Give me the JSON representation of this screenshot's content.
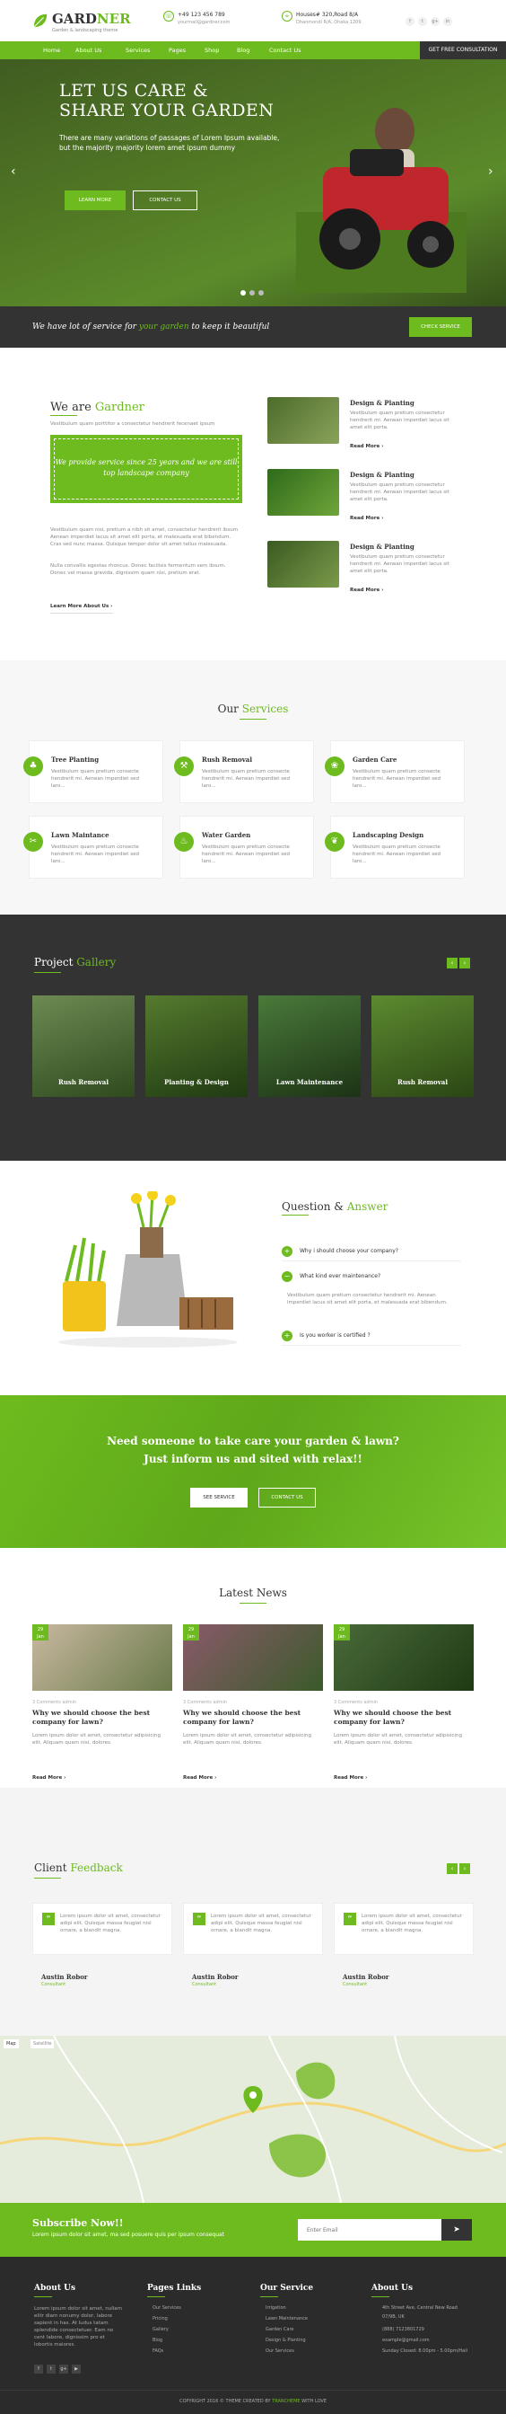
{
  "brand": {
    "name_a": "GARD",
    "name_b": "NER",
    "tagline": "Garden & landscaping theme"
  },
  "header": {
    "phone": "+49 123 456 789",
    "email": "yourmail@gardner.com",
    "address": "Houses# 320,Road 8/A",
    "address_sub": "Dhanmondi R/A, Dhaka 1209",
    "social": [
      "f",
      "t",
      "g+",
      "in"
    ]
  },
  "nav": {
    "items": [
      "Home",
      "About Us",
      "Services",
      "Pages",
      "Shop",
      "Blog",
      "Contact Us"
    ],
    "cta": "GET FREE CONSULTATION"
  },
  "hero": {
    "title_line1": "LET US CARE &",
    "title_line2": "SHARE YOUR GARDEN",
    "lead": "There are many variations of passages of Lorem Ipsum available, but the majority majority lorem amet ipsum dummy",
    "btn_learn": "LEARN MORE",
    "btn_contact": "CONTACT US",
    "prev": "‹",
    "next": "›"
  },
  "strip": {
    "text_a": "We have lot of service for ",
    "text_b": "your garden",
    "text_c": " to keep it beautiful",
    "btn": "CHECK SERVICE"
  },
  "about": {
    "title_a": "We are ",
    "title_b": "Gardner",
    "intro": "Vestibulum quam porttitor a consectetur hendrerit fecenaet ipsum",
    "quote": "We provide service since 25 years and we are still top landscape company",
    "para1": "Vestibulum quam nisi, pretium a nibh sit amet, consectetur hendrerit ibsum Aenean imperdiet lacus sit amet elit porta, et malesuada erat bibendum. Cras sed nunc massa. Quisque tempor dolor sit amet tellus malesuada.",
    "para2": "Nulla convallis egestas rhoncus. Donec facilisis fermentum sem ibsum. Donec vel massa gravida, dignissim quam nisi, pretium erat.",
    "link": "Learn More About Us ›",
    "features": [
      {
        "title": "Design & Planting",
        "desc": "Vestibulum quam pretium consectetur hendrerit mi. Aenean imperdiet lacus sit amet elit porta.",
        "more": "Read More ›"
      },
      {
        "title": "Design & Planting",
        "desc": "Vestibulum quam pretium consectetur hendrerit mi. Aenean imperdiet lacus sit amet elit porta.",
        "more": "Read More ›"
      },
      {
        "title": "Design & Planting",
        "desc": "Vestibulum quam pretium consectetur hendrerit mi. Aenean imperdiet lacus sit amet elit porta.",
        "more": "Read More ›"
      }
    ]
  },
  "services": {
    "title_a": "Our ",
    "title_b": "Services",
    "items": [
      {
        "title": "Tree Planting",
        "desc": "Vestibulum quam pretium consecte hendrerit mi. Aenean imperdiet sed laro..."
      },
      {
        "title": "Rush Removal",
        "desc": "Vestibulum quam pretium consecte hendrerit mi. Aenean imperdiet sed laro..."
      },
      {
        "title": "Garden Care",
        "desc": "Vestibulum quam pretium consecte hendrerit mi. Aenean imperdiet sed laro..."
      },
      {
        "title": "Lawn Maintance",
        "desc": "Vestibulum quam pretium consecte hendrerit mi. Aenean imperdiet sed laro..."
      },
      {
        "title": "Water Garden",
        "desc": "Vestibulum quam pretium consecte hendrerit mi. Aenean imperdiet sed laro..."
      },
      {
        "title": "Landscaping Design",
        "desc": "Vestibulum quam pretium consecte hendrerit mi. Aenean imperdiet sed laro..."
      }
    ]
  },
  "gallery": {
    "title_a": "Project ",
    "title_b": "Gallery",
    "prev": "‹",
    "next": "›",
    "items": [
      "Rush Removal",
      "Planting & Design",
      "Lawn Maintenance",
      "Rush Removal"
    ]
  },
  "faq": {
    "title_a": "Question & ",
    "title_b": "Answer",
    "items": [
      {
        "q": "Why i should choose your company?",
        "icon": "+"
      },
      {
        "q": "What kind ever maintenance?",
        "icon": "−"
      },
      {
        "q": "Is you worker is certified ?",
        "icon": "+"
      }
    ],
    "answer": "Vestibulum quam pretium consectetur hendrerit mi. Aenean imperdiet lacus sit amet elit porta, et malesuada erat bibendum."
  },
  "cta": {
    "text": "Need someone to take care your garden & lawn? Just inform us and sited with relax!!",
    "btn_service": "SEE SERVICE",
    "btn_contact": "CONTACT US"
  },
  "news": {
    "title": "Latest News",
    "items": [
      {
        "day": "29",
        "mon": "Jan",
        "meta": "3 Comments   admin",
        "title": "Why we should choose the best company for lawn?",
        "desc": "Lorem ipsum dolor sit amet, consectetur adipisicing elit. Aliquam quam nisi, dolores.",
        "more": "Read More ›"
      },
      {
        "day": "29",
        "mon": "Jan",
        "meta": "3 Comments   admin",
        "title": "Why we should choose the best company for lawn?",
        "desc": "Lorem ipsum dolor sit amet, consectetur adipisicing elit. Aliquam quam nisi, dolores.",
        "more": "Read More ›"
      },
      {
        "day": "29",
        "mon": "Jan",
        "meta": "3 Comments   admin",
        "title": "Why we should choose the best company for lawn?",
        "desc": "Lorem ipsum dolor sit amet, consectetur adipisicing elit. Aliquam quam nisi, dolores.",
        "more": "Read More ›"
      }
    ]
  },
  "feedback": {
    "title_a": "Client ",
    "title_b": "Feedback",
    "prev": "‹",
    "next": "›",
    "items": [
      {
        "text": "Lorem ipsum dolor sit amet, consectetur adipi elit. Quisque massa feugiat nisl ornare, a blandit magna.",
        "name": "Austin Robor",
        "role": "Consultant"
      },
      {
        "text": "Lorem ipsum dolor sit amet, consectetur adipi elit. Quisque massa feugiat nisl ornare, a blandit magna.",
        "name": "Austin Robor",
        "role": "Consultant"
      },
      {
        "text": "Lorem ipsum dolor sit amet, consectetur adipi elit. Quisque massa feugiat nisl ornare, a blandit magna.",
        "name": "Austin Robor",
        "role": "Consultant"
      }
    ]
  },
  "map": {
    "tab_map": "Map",
    "tab_sat": "Satellite"
  },
  "subscribe": {
    "title": "Subscribe Now!!",
    "desc": "Lorem ipsum dolor sit amet, ma sed posuere quis per ipsum consequat",
    "placeholder": "Enter Email",
    "btn": "➤"
  },
  "footer": {
    "about_title": "About Us",
    "about_text": "Lorem ipsum dolor sit amet, nullam elitr diam nonumy dolor, labore sapient in has. At ludus tatam splendide consectetuer. Eam no cent labore, dignissim pro et lobortis maiores.",
    "pages_title": "Pages Links",
    "pages": [
      "Our Services",
      "Pricing",
      "Gallery",
      "Blog",
      "FAQs"
    ],
    "service_title": "Our Service",
    "service": [
      "Irrigation",
      "Lawn Maintenance",
      "Garden Care",
      "Design & Planting",
      "Our Services"
    ],
    "contact_title": "About Us",
    "contact": [
      "4th Street Ave, Central New Road",
      "07/9B, UK",
      "(888) 7123801729",
      "example@gmail.com",
      "Sunday Closed: 8.00pm - 5.00pm/Hall"
    ],
    "social": [
      "f",
      "t",
      "g+",
      "▶"
    ],
    "copyright": "COPYRIGHT 2016 © THEME CREATED BY ",
    "copyright_brand": "TRANCHEME",
    "copyright_end": " WITH LOVE"
  },
  "colors": {
    "accent": "#6dbb1e",
    "dark": "#333333",
    "footer": "#2b2b2b"
  }
}
